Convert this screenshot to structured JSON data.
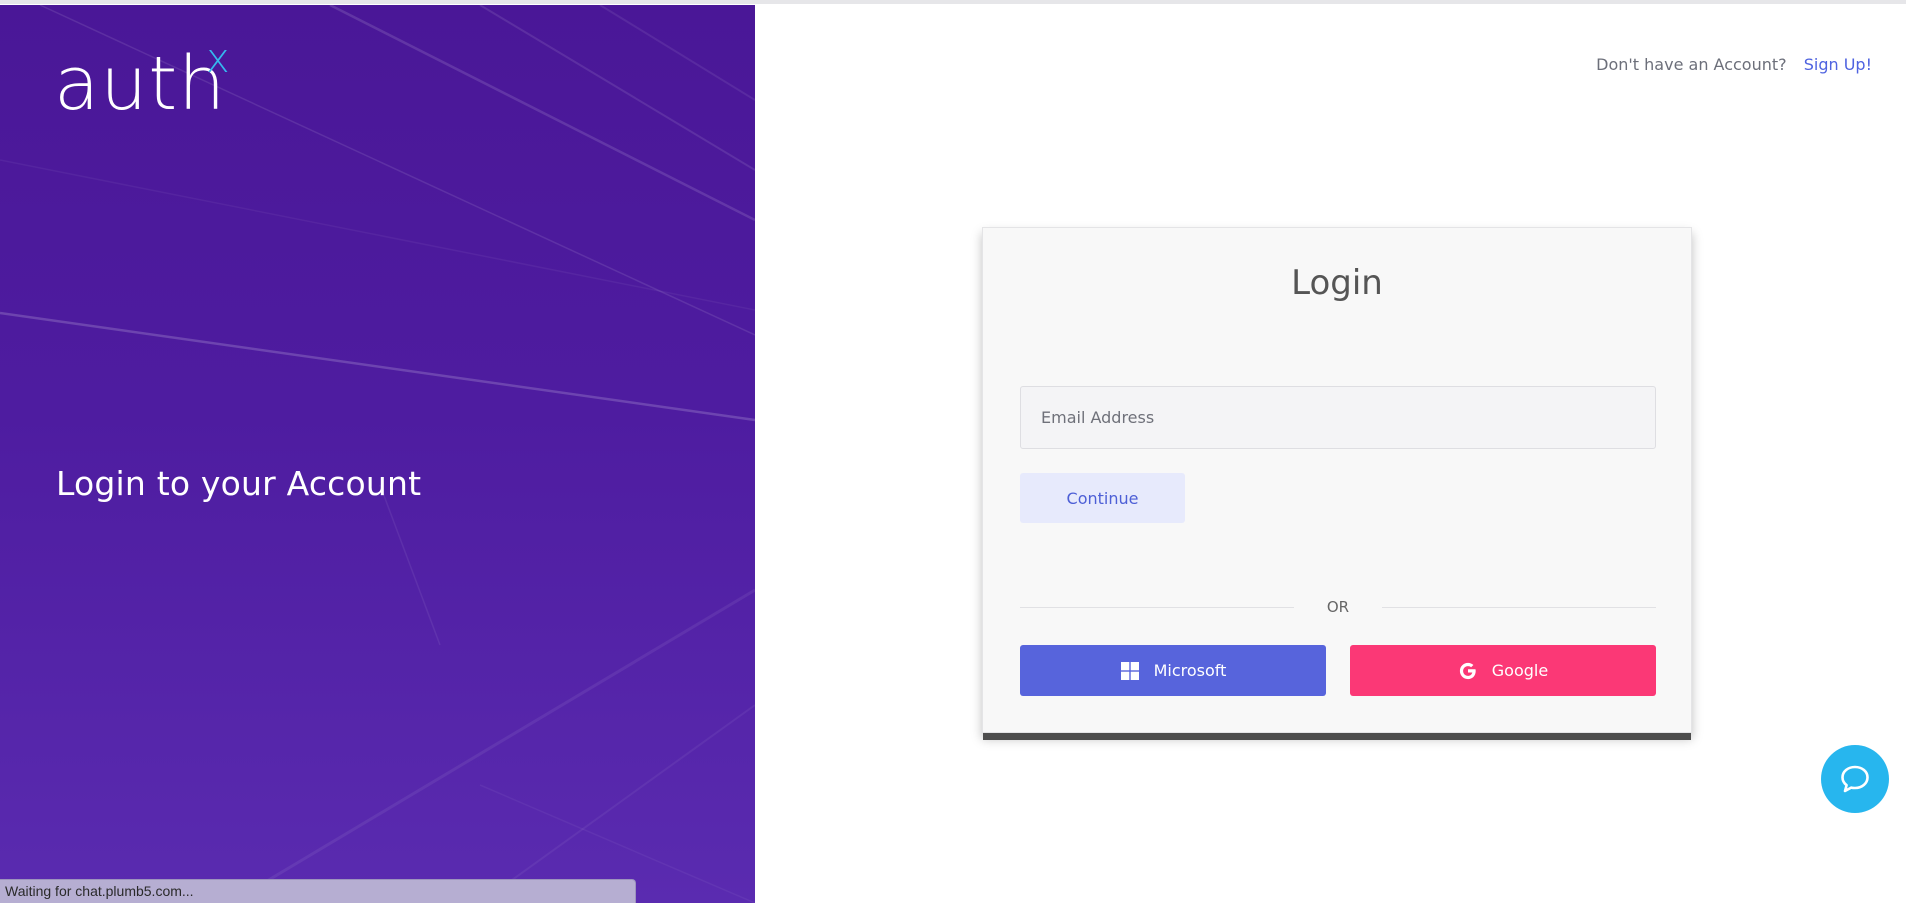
{
  "brand": {
    "logo_text": "auth",
    "logo_superscript": "x",
    "accent_color": "#35b8ee",
    "panel_color": "#4a1797"
  },
  "left_panel": {
    "heading": "Login to your Account"
  },
  "status_bar": {
    "text": "Waiting for chat.plumb5.com..."
  },
  "header": {
    "signup_prompt": "Don't have an Account?",
    "signup_link": "Sign Up!"
  },
  "login_card": {
    "title": "Login",
    "email_placeholder": "Email Address",
    "email_value": "",
    "continue_label": "Continue",
    "divider_text": "OR",
    "microsoft_label": "Microsoft",
    "microsoft_icon": "windows-logo-icon",
    "microsoft_color": "#5764dc",
    "google_label": "Google",
    "google_icon": "google-g-icon",
    "google_color": "#fb3876"
  },
  "chat_widget": {
    "icon": "chat-bubble-icon",
    "color": "#27b6ee"
  }
}
